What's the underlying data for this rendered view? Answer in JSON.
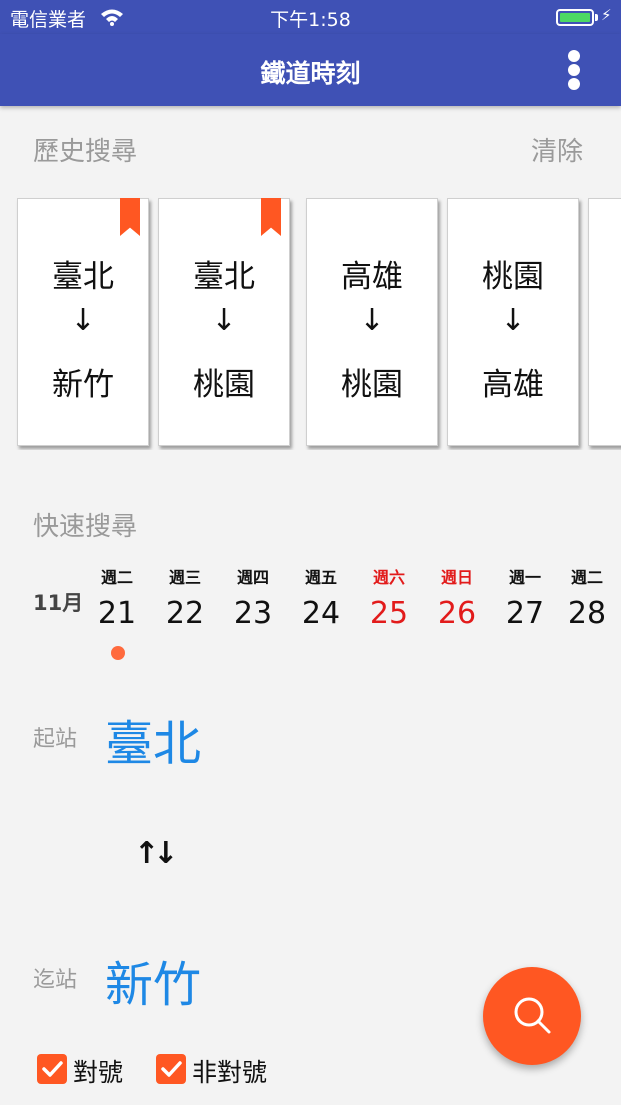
{
  "status_bar": {
    "carrier": "電信業者",
    "time": "下午1:58",
    "wifi_icon": "wifi-icon",
    "battery_icon": "battery-charging-icon"
  },
  "app_bar": {
    "title": "鐵道時刻",
    "menu_icon": "more-vertical-icon"
  },
  "history": {
    "label": "歷史搜尋",
    "clear_label": "清除",
    "arrow": "↓",
    "cards": [
      {
        "from": "臺北",
        "to": "新竹",
        "bookmarked": true
      },
      {
        "from": "臺北",
        "to": "桃園",
        "bookmarked": true
      },
      {
        "from": "高雄",
        "to": "桃園",
        "bookmarked": false
      },
      {
        "from": "桃園",
        "to": "高雄",
        "bookmarked": false
      },
      {
        "from": "",
        "to": "",
        "bookmarked": false
      }
    ]
  },
  "quick_search": {
    "label": "快速搜尋",
    "month": "11月",
    "days": [
      {
        "weekday": "週二",
        "date": "21",
        "weekend": false,
        "selected": true
      },
      {
        "weekday": "週三",
        "date": "22",
        "weekend": false,
        "selected": false
      },
      {
        "weekday": "週四",
        "date": "23",
        "weekend": false,
        "selected": false
      },
      {
        "weekday": "週五",
        "date": "24",
        "weekend": false,
        "selected": false
      },
      {
        "weekday": "週六",
        "date": "25",
        "weekend": true,
        "selected": false
      },
      {
        "weekday": "週日",
        "date": "26",
        "weekend": true,
        "selected": false
      },
      {
        "weekday": "週一",
        "date": "27",
        "weekend": false,
        "selected": false
      },
      {
        "weekday": "週二",
        "date": "28",
        "weekend": false,
        "selected": false
      }
    ]
  },
  "stations": {
    "from_label": "起站",
    "from_value": "臺北",
    "swap_icon": "swap-vertical-icon",
    "swap_glyph": "↑↓",
    "to_label": "迄站",
    "to_value": "新竹"
  },
  "filters": [
    {
      "label": "對號",
      "checked": true
    },
    {
      "label": "非對號",
      "checked": true
    }
  ],
  "search_button": {
    "icon": "search-icon"
  },
  "colors": {
    "primary": "#3f51b5",
    "accent": "#ff5722",
    "station_blue": "#1e88e5",
    "weekend_red": "#e21b1b",
    "battery_green": "#4cd964"
  }
}
